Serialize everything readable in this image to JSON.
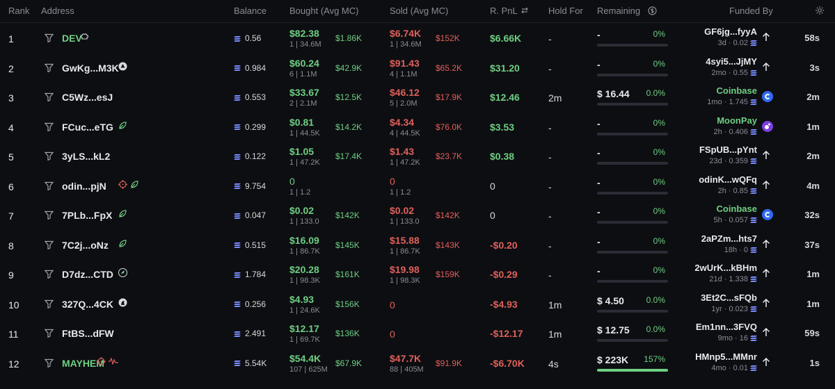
{
  "header": {
    "rank": "Rank",
    "address": "Address",
    "balance": "Balance",
    "bought": "Bought (Avg MC)",
    "sold": "Sold (Avg MC)",
    "rpnl": "R. PnL",
    "hold_for": "Hold For",
    "remaining": "Remaining",
    "funded_by": "Funded By"
  },
  "colors": {
    "green": "#6fcf82",
    "red": "#e0605a",
    "bg": "#0d0e12"
  },
  "rows": [
    {
      "rank": "1",
      "address": "DEV",
      "address_green": true,
      "icons": [
        "chef-hat-icon"
      ],
      "balance": "0.56",
      "bought": "$82.38",
      "bought_sub": "1 | 34.6M",
      "bought_mc": "$1.86K",
      "sold": "$6.74K",
      "sold_sub": "1 | 34.6M",
      "sold_mc": "$152K",
      "pnl": "$6.66K",
      "pnl_sign": "pos",
      "hold": "-",
      "remaining": "-",
      "remaining_pct": "0%",
      "remaining_frac": 0,
      "funded": "GF6jg...fyyA",
      "funded_green": false,
      "funded_sub": "3d · 0.02",
      "funded_icon": "arrow-up-icon",
      "ago": "58s"
    },
    {
      "rank": "2",
      "address": "GwKg...M3K",
      "address_green": false,
      "icons": [
        "triangle-circle-icon"
      ],
      "balance": "0.984",
      "bought": "$60.24",
      "bought_sub": "6 | 1.1M",
      "bought_mc": "$42.9K",
      "sold": "$91.43",
      "sold_sub": "4 | 1.1M",
      "sold_mc": "$65.2K",
      "pnl": "$31.20",
      "pnl_sign": "pos",
      "hold": "-",
      "remaining": "-",
      "remaining_pct": "0%",
      "remaining_frac": 0,
      "funded": "4syi5...JjMY",
      "funded_green": false,
      "funded_sub": "2mo · 0.55",
      "funded_icon": "arrow-up-icon",
      "ago": "3s"
    },
    {
      "rank": "3",
      "address": "C5Wz...esJ",
      "address_green": false,
      "icons": [],
      "balance": "0.553",
      "bought": "$33.67",
      "bought_sub": "2 | 2.1M",
      "bought_mc": "$12.5K",
      "sold": "$46.12",
      "sold_sub": "5 | 2.0M",
      "sold_mc": "$17.9K",
      "pnl": "$12.46",
      "pnl_sign": "pos",
      "hold": "2m",
      "remaining": "$ 16.44",
      "remaining_pct": "0.0%",
      "remaining_frac": 0,
      "funded": "Coinbase",
      "funded_green": true,
      "funded_sub": "1mo · 1.745",
      "funded_icon": "coinbase-icon",
      "ago": "2m"
    },
    {
      "rank": "4",
      "address": "FCuc...eTG",
      "address_green": false,
      "icons": [
        "leaf-icon"
      ],
      "balance": "0.299",
      "bought": "$0.81",
      "bought_sub": "1 | 44.5K",
      "bought_mc": "$14.2K",
      "sold": "$4.34",
      "sold_sub": "4 | 44.5K",
      "sold_mc": "$76.0K",
      "pnl": "$3.53",
      "pnl_sign": "pos",
      "hold": "-",
      "remaining": "-",
      "remaining_pct": "0%",
      "remaining_frac": 0,
      "funded": "MoonPay",
      "funded_green": true,
      "funded_sub": "2h · 0.406",
      "funded_icon": "moonpay-icon",
      "ago": "1m"
    },
    {
      "rank": "5",
      "address": "3yLS...kL2",
      "address_green": false,
      "icons": [],
      "balance": "0.122",
      "bought": "$1.05",
      "bought_sub": "1 | 47.2K",
      "bought_mc": "$17.4K",
      "sold": "$1.43",
      "sold_sub": "1 | 47.2K",
      "sold_mc": "$23.7K",
      "pnl": "$0.38",
      "pnl_sign": "pos",
      "hold": "-",
      "remaining": "-",
      "remaining_pct": "0%",
      "remaining_frac": 0,
      "funded": "FSpUB...pYnt",
      "funded_green": false,
      "funded_sub": "23d · 0.359",
      "funded_icon": "arrow-up-icon",
      "ago": "2m"
    },
    {
      "rank": "6",
      "address": "odin...pjN",
      "address_green": false,
      "icons": [
        "crosshair-icon",
        "leaf-icon"
      ],
      "balance": "9.754",
      "bought": "0",
      "bought_sub": "1 | 1.2",
      "bought_mc": "",
      "sold": "0",
      "sold_sub": "1 | 1.2",
      "sold_mc": "",
      "pnl": "0",
      "pnl_sign": "neu",
      "hold": "-",
      "remaining": "-",
      "remaining_pct": "0%",
      "remaining_frac": 0,
      "funded": "odinK...wQFq",
      "funded_green": false,
      "funded_sub": "2h · 0.85",
      "funded_icon": "arrow-up-icon",
      "ago": "4m"
    },
    {
      "rank": "7",
      "address": "7PLb...FpX",
      "address_green": false,
      "icons": [
        "leaf-icon"
      ],
      "balance": "0.047",
      "bought": "$0.02",
      "bought_sub": "1 | 133.0",
      "bought_mc": "$142K",
      "sold": "$0.02",
      "sold_sub": "1 | 133.0",
      "sold_mc": "$142K",
      "pnl": "0",
      "pnl_sign": "neu",
      "hold": "-",
      "remaining": "-",
      "remaining_pct": "0%",
      "remaining_frac": 0,
      "funded": "Coinbase",
      "funded_green": true,
      "funded_sub": "5h · 0.057",
      "funded_icon": "coinbase-icon",
      "ago": "32s"
    },
    {
      "rank": "8",
      "address": "7C2j...oNz",
      "address_green": false,
      "icons": [
        "leaf-icon"
      ],
      "balance": "0.515",
      "bought": "$16.09",
      "bought_sub": "1 | 86.7K",
      "bought_mc": "$145K",
      "sold": "$15.88",
      "sold_sub": "1 | 86.7K",
      "sold_mc": "$143K",
      "pnl": "-$0.20",
      "pnl_sign": "neg",
      "hold": "-",
      "remaining": "-",
      "remaining_pct": "0%",
      "remaining_frac": 0,
      "funded": "2aPZm...hts7",
      "funded_green": false,
      "funded_sub": "18h · 0",
      "funded_icon": "arrow-up-icon",
      "ago": "37s"
    },
    {
      "rank": "9",
      "address": "D7dz...CTD",
      "address_green": false,
      "icons": [
        "rocket-icon"
      ],
      "balance": "1.784",
      "bought": "$20.28",
      "bought_sub": "1 | 98.3K",
      "bought_mc": "$161K",
      "sold": "$19.98",
      "sold_sub": "1 | 98.3K",
      "sold_mc": "$159K",
      "pnl": "-$0.29",
      "pnl_sign": "neg",
      "hold": "-",
      "remaining": "-",
      "remaining_pct": "0%",
      "remaining_frac": 0,
      "funded": "2wUrK...kBHm",
      "funded_green": false,
      "funded_sub": "21d · 1.338",
      "funded_icon": "arrow-up-icon",
      "ago": "1m"
    },
    {
      "rank": "10",
      "address": "327Q...4CK",
      "address_green": false,
      "icons": [
        "horse-icon"
      ],
      "balance": "0.256",
      "bought": "$4.93",
      "bought_sub": "1 | 24.6K",
      "bought_mc": "$156K",
      "sold": "0",
      "sold_sub": "",
      "sold_mc": "",
      "pnl": "-$4.93",
      "pnl_sign": "neg",
      "hold": "1m",
      "remaining": "$ 4.50",
      "remaining_pct": "0.0%",
      "remaining_frac": 0,
      "funded": "3Et2C...sFQb",
      "funded_green": false,
      "funded_sub": "1yr · 0.023",
      "funded_icon": "arrow-up-icon",
      "ago": "1m"
    },
    {
      "rank": "11",
      "address": "FtBS...dFW",
      "address_green": false,
      "icons": [],
      "balance": "2.491",
      "bought": "$12.17",
      "bought_sub": "1 | 69.7K",
      "bought_mc": "$136K",
      "sold": "0",
      "sold_sub": "",
      "sold_mc": "",
      "pnl": "-$12.17",
      "pnl_sign": "neg",
      "hold": "1m",
      "remaining": "$ 12.75",
      "remaining_pct": "0.0%",
      "remaining_frac": 0,
      "funded": "Em1nn...3FVQ",
      "funded_green": false,
      "funded_sub": "9mo · 16",
      "funded_icon": "arrow-up-icon",
      "ago": "59s"
    },
    {
      "rank": "12",
      "address": "MAYHEM",
      "address_green": true,
      "icons": [
        "crosshair-icon",
        "wave-icon"
      ],
      "balance": "5.54K",
      "bought": "$54.4K",
      "bought_sub": "107 | 625M",
      "bought_mc": "$67.9K",
      "sold": "$47.7K",
      "sold_sub": "88 | 405M",
      "sold_mc": "$91.9K",
      "pnl": "-$6.70K",
      "pnl_sign": "neg",
      "hold": "4s",
      "remaining": "$ 223K",
      "remaining_pct": "157%",
      "remaining_frac": 1,
      "funded": "HMnp5...MMnr",
      "funded_green": false,
      "funded_sub": "4mo · 0.01",
      "funded_icon": "arrow-up-icon",
      "ago": "1s"
    }
  ]
}
